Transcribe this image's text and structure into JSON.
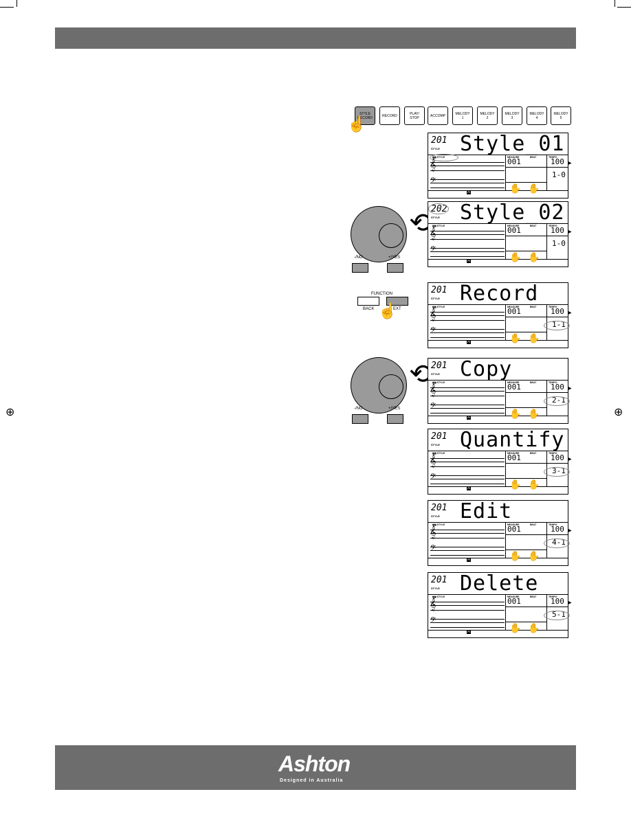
{
  "panel_buttons": [
    {
      "label": "STYLE\nRECORD",
      "active": true
    },
    {
      "label": "RECORD"
    },
    {
      "label": "PLAY/\nSTOP"
    },
    {
      "label": "ACCOMP"
    },
    {
      "label": "MELODY\n1"
    },
    {
      "label": "MELODY\n2"
    },
    {
      "label": "MELODY\n3"
    },
    {
      "label": "MELODY\n4"
    },
    {
      "label": "MELODY\n5"
    }
  ],
  "dial": {
    "no_label": "-/NO",
    "yes_label": "+/YES"
  },
  "function": {
    "title": "FUNCTION",
    "back_label": "BACK",
    "next_label": "EXT"
  },
  "lcd_labels": {
    "style": "STYLE",
    "user_style": "STYLE",
    "measure": "MEASURE",
    "beat": "BEAT",
    "tempo": "TEMPO",
    "measure_value": "001",
    "tempo_value": "100",
    "chord": "A"
  },
  "lcd_screens": [
    {
      "number": "201",
      "text": "Style_01",
      "value": "1-0",
      "circled": "user_style"
    },
    {
      "number": "202",
      "text": "Style_02",
      "value": "1-0",
      "circled": "number"
    },
    {
      "number": "201",
      "text": "Record",
      "value": "1-1",
      "circled": "value"
    },
    {
      "number": "201",
      "text": "Copy",
      "value": "2-1",
      "circled": "value"
    },
    {
      "number": "201",
      "text": "Quantify",
      "value": "3-1",
      "circled": "value"
    },
    {
      "number": "201",
      "text": "Edit",
      "value": "4-1",
      "circled": "value"
    },
    {
      "number": "201",
      "text": "Delete",
      "value": "5-1",
      "circled": "value"
    }
  ],
  "footer": {
    "brand": "Ashton",
    "tagline": "Designed in Australia"
  },
  "colors": {
    "bar": "#6d6d6d",
    "button_active": "#9a9a9a"
  }
}
